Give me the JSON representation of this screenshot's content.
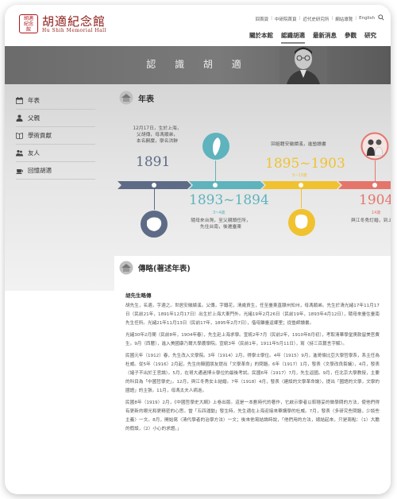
{
  "site": {
    "logo_seal": "胡適紀念館",
    "logo_cn": "胡適紀念館",
    "logo_en": "Hu Shih Memorial Hall"
  },
  "utility_nav": [
    "回首頁",
    "中研院首頁",
    "近代史研究所",
    "網站導覽",
    "English"
  ],
  "main_nav": [
    {
      "label": "關於本館",
      "active": false
    },
    {
      "label": "認識胡適",
      "active": true
    },
    {
      "label": "最新消息",
      "active": false
    },
    {
      "label": "參觀",
      "active": false
    },
    {
      "label": "研究",
      "active": false
    }
  ],
  "banner": {
    "title": "認 識 胡 適"
  },
  "sidebar": [
    {
      "label": "年表",
      "icon": "calendar-icon"
    },
    {
      "label": "父親",
      "icon": "person-icon"
    },
    {
      "label": "學術貢獻",
      "icon": "book-icon"
    },
    {
      "label": "友人",
      "icon": "people-icon"
    },
    {
      "label": "回憶胡適",
      "icon": "cup-icon"
    }
  ],
  "timeline": {
    "heading": "年表",
    "events": [
      {
        "year": "1891",
        "age": "",
        "desc": [
          "12月17日，生於上海，",
          "父胡傳，母馮順弟，",
          "本名嗣穈，學名洪騂"
        ],
        "color": "#5d6b86"
      },
      {
        "year": "1893~1894",
        "age": "3~4歲",
        "desc": [
          "隨母來台灣，至父親頭任所，",
          "先住台南，後遷臺東"
        ],
        "color": "#5eb3bd"
      },
      {
        "year": "1895~1903",
        "age": "5~13歲",
        "desc": [
          "回祖籍安徽績溪，進塾讀書"
        ],
        "color": "#f0c22f"
      },
      {
        "year": "1904",
        "age": "14歲",
        "desc": [
          "與江冬秀訂婚，到上海"
        ],
        "color": "#e4756b"
      }
    ]
  },
  "bio": {
    "heading": "傳略(著述年表)",
    "subheading": "胡先生略傳",
    "paragraphs": [
      "胡先生，名適，字適之。世居安徽績溪。父傳，字鐵花，清歲貢生，任至臺東直隸州知州，母馮順弟。先生於清光緒17年11月17日（民前21年，1891年12月17日）出生於上海大東門外。光緒19年2月26日（民前19年，1893年4月12日），隨母來臺住臺南先生任所。光緒21年11月13日（民前17年，1895年2月7日），偕母離臺返鄉里；從塾師讀書。",
      "光緒30年2月間（民前8年，1904年春），先生赴上海求學。宣統2年7月（民前2年，1910年8月初），考取清華學堂庚款留美官費生。9月（西曆），進入美國康乃爾大學農學院。宣統3年（民前1年，1911年5月11日），寫〈詩三百篇言字解〉。",
      "民國元年（1912）春，先生改入文學院。3年（1914）2月，得學士學位。4年（1915）9月，進哥倫比亞大學哲學系，系主任為杜威。從5年（1916）2月起，先生向韓國朋友提出「文學革命」的問題。6年（1917）1月，發表〈文學改良芻議〉，4月，發表〈諸子不出於王官論〉。5月，在哥大通過博士學位的最後考試。民國6年（1917）7月，先生返國。9月，任北京大學教授，主要的科目為「中國哲學史」。12月，與江冬秀女士結婚。7年（1918）4月，發表〈建設的文學革命論〉，提出「國語的文學，文學的國語」的主張。11月，母馮太夫人病逝。",
      "民國8年（1919）2月，《中國哲學史大綱》上卷出版。這是一本劃時代的著作，它啟示學者以較穩妥的做學問的方法，使他們得有更新的眼光和更精密的心思。當「五四運動」發生時，先生適在上海迎接來華講學的杜威。7月，發表〈多研究些問題，少談些主義〉一文。8月，開始寫〈清代學者的治學方法〉一文；後來他寫結論時說，「他們用的方法，總結起來，只是兩點：（1）大膽的假設，（2）小心的求證。」"
    ]
  }
}
